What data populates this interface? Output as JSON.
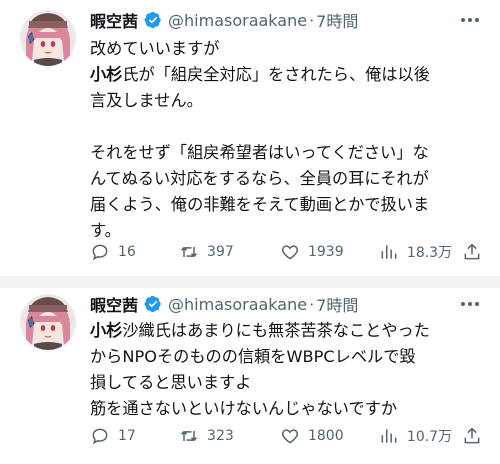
{
  "tweets": [
    {
      "display_name": "暇空茜",
      "handle": "@himasoraakane",
      "separator": "·",
      "time": "7時間",
      "lines": [
        {
          "segments": [
            {
              "text": "改めていいますが",
              "bold": false
            }
          ]
        },
        {
          "segments": [
            {
              "text": "小杉",
              "bold": true
            },
            {
              "text": "氏が「組戻全対応」をされたら、俺は以後",
              "bold": false
            }
          ]
        },
        {
          "segments": [
            {
              "text": "言及しません。",
              "bold": false
            }
          ]
        },
        {
          "segments": []
        },
        {
          "segments": [
            {
              "text": "それをせず「組戻希望者はいってください」な",
              "bold": false
            }
          ]
        },
        {
          "segments": [
            {
              "text": "んてぬるい対応をするなら、全員の耳にそれが",
              "bold": false
            }
          ]
        },
        {
          "segments": [
            {
              "text": "届くよう、俺の非難をそえて動画とかで扱いま",
              "bold": false
            }
          ]
        },
        {
          "segments": [
            {
              "text": "す。",
              "bold": false
            }
          ]
        }
      ],
      "stats": {
        "replies": "16",
        "retweets": "397",
        "likes": "1939",
        "views": "18.3万"
      }
    },
    {
      "display_name": "暇空茜",
      "handle": "@himasoraakane",
      "separator": "·",
      "time": "7時間",
      "lines": [
        {
          "segments": [
            {
              "text": "小杉",
              "bold": true
            },
            {
              "text": "沙織氏はあまりにも無茶苦茶なことやった",
              "bold": false
            }
          ]
        },
        {
          "segments": [
            {
              "text": "からNPOそのものの信頼をWBPCレベルで毀",
              "bold": false
            }
          ]
        },
        {
          "segments": [
            {
              "text": "損してると思いますよ",
              "bold": false
            }
          ]
        },
        {
          "segments": [
            {
              "text": "筋を通さないといけないんじゃないですか",
              "bold": false
            }
          ]
        }
      ],
      "stats": {
        "replies": "17",
        "retweets": "323",
        "likes": "1800",
        "views": "10.7万"
      }
    }
  ],
  "icons": {
    "verified": "verified-badge-icon",
    "more": "more-horizontal-icon",
    "reply": "reply-bubble-icon",
    "retweet": "retweet-arrows-icon",
    "like": "heart-icon",
    "views": "views-bar-chart-icon",
    "share": "share-upload-icon"
  },
  "colors": {
    "verified_blue": "#1d9bf0",
    "secondary_text": "#536471",
    "primary_text": "#0f1419",
    "divider": "#f2f3f4"
  }
}
